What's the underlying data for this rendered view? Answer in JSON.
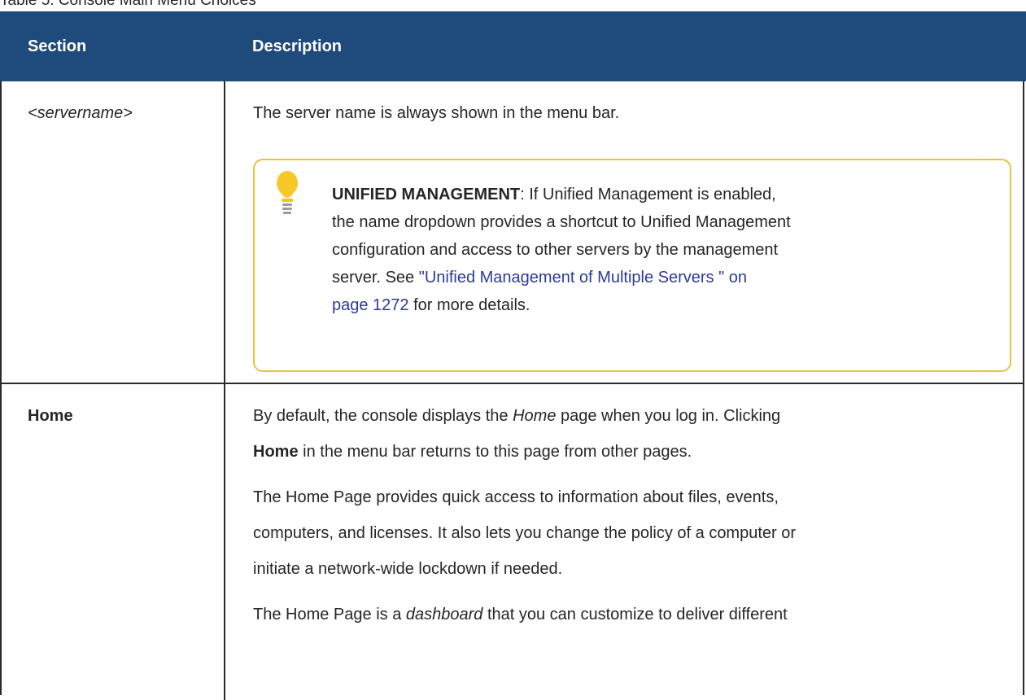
{
  "caption": "Table 5: Console Main Menu Choices",
  "table": {
    "headers": [
      "Section",
      "Description"
    ],
    "rows": [
      {
        "section": "<servername>",
        "description": "The server name is always shown in the menu bar.",
        "note": {
          "icon": "lightbulb-icon",
          "title": "UNIFIED MANAGEMENT",
          "line1_rest": ": If Unified Management is enabled,",
          "line2": "the name dropdown provides a shortcut to Unified Management",
          "line3": "configuration and access to other servers by the management",
          "line4_pre": "server. See ",
          "link_part1": "\"Unified Management of Multiple Servers \" on",
          "link_part2": "page 1272",
          "line5_post": " for more details."
        }
      },
      {
        "section": "Home",
        "p1_line1_pre": "By default, the console displays the ",
        "p1_line1_ital": "Home",
        "p1_line1_post": " page when you log in. Clicking",
        "p1_line2_bold": "Home",
        "p1_line2_post": " in the menu bar returns to this page from other pages.",
        "p2_line1": "The Home Page provides quick access to information about files, events,",
        "p2_line2": "computers, and licenses. It also lets you change the policy of a computer or",
        "p2_line3": "initiate a network-wide lockdown if needed.",
        "p3_line1_pre": "The Home Page is a ",
        "p3_line1_ital": "dashboard",
        "p3_line1_post": " that you can customize to deliver different"
      }
    ]
  },
  "colors": {
    "header_bg": "#1f4a7c",
    "note_border": "#e8c33a",
    "link": "#2d3a9a"
  }
}
